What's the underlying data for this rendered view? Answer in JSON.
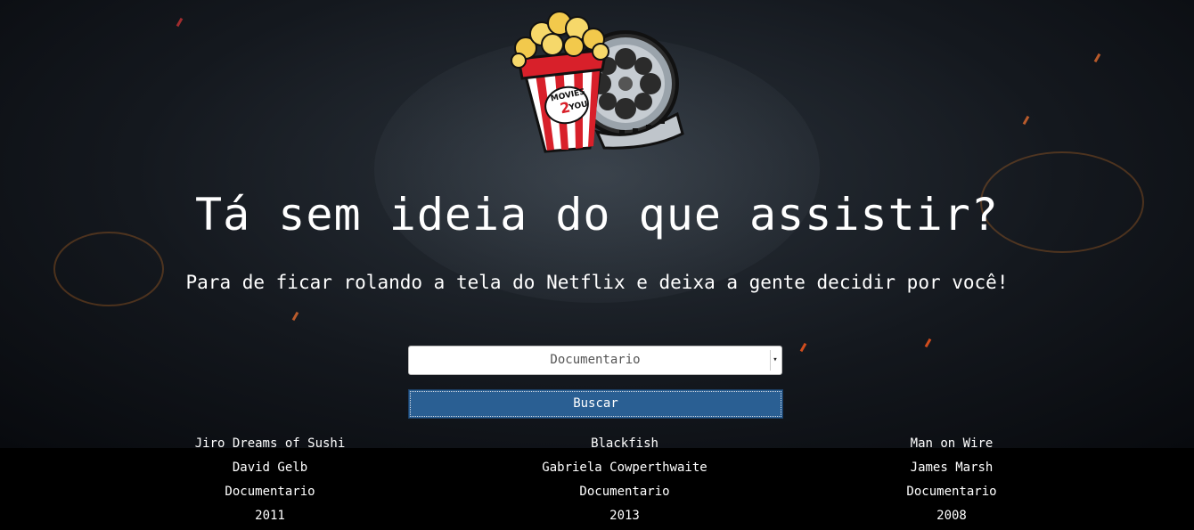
{
  "hero": {
    "headline": "Tá sem ideia do que assistir?",
    "subheadline": "Para de ficar rolando a tela do Netflix e deixa a gente decidir por você!"
  },
  "logo": {
    "text_top": "MOVIES",
    "text_mid": "2",
    "text_bottom": "YOU",
    "icon": "popcorn-film-reel-logo"
  },
  "form": {
    "genre_selected": "Documentario",
    "search_label": "Buscar"
  },
  "results": [
    {
      "title": "Jiro Dreams of Sushi",
      "director": "David Gelb",
      "genre": "Documentario",
      "year": "2011"
    },
    {
      "title": "Blackfish",
      "director": "Gabriela Cowperthwaite",
      "genre": "Documentario",
      "year": "2013"
    },
    {
      "title": "Man on Wire",
      "director": "James Marsh",
      "genre": "Documentario",
      "year": "2008"
    }
  ],
  "colors": {
    "button": "#2a5f93",
    "background": "#000000",
    "text": "#ffffff"
  }
}
